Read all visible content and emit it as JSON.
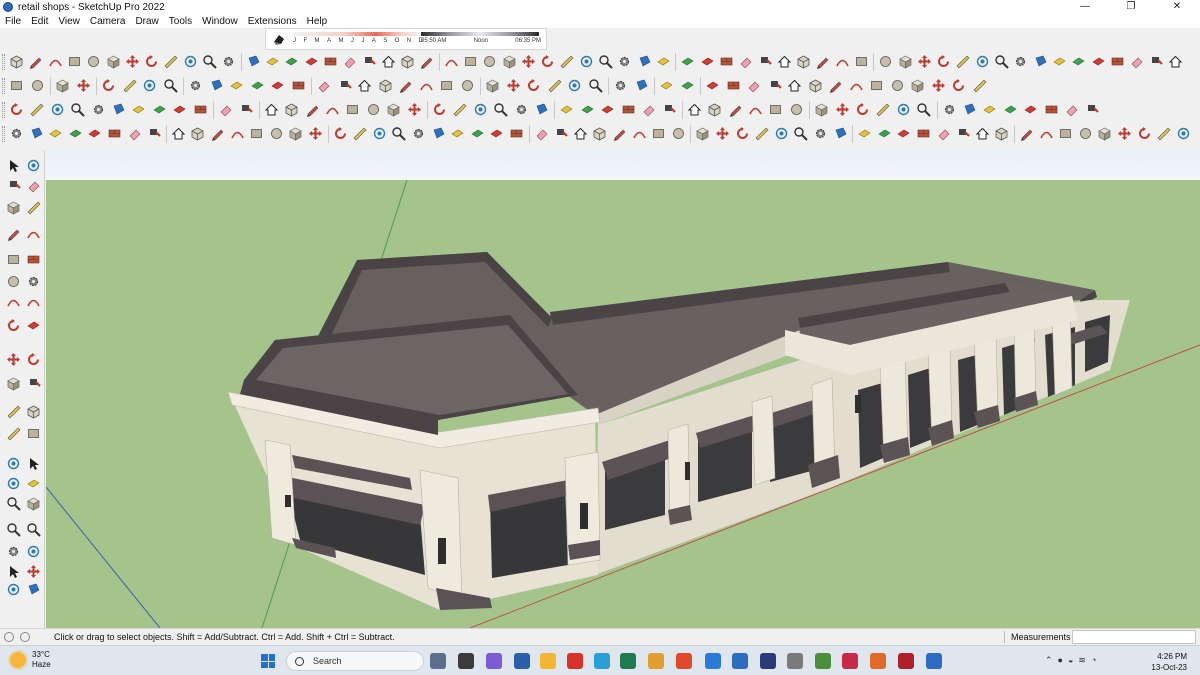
{
  "window": {
    "title": "retail shops - SketchUp Pro 2022",
    "controls": [
      "—",
      "❐",
      "✕"
    ]
  },
  "menu": [
    "File",
    "Edit",
    "View",
    "Camera",
    "Draw",
    "Tools",
    "Window",
    "Extensions",
    "Help"
  ],
  "shadow_widget": {
    "months": [
      "J",
      "F",
      "M",
      "A",
      "M",
      "J",
      "J",
      "A",
      "S",
      "O",
      "N",
      "D"
    ],
    "time_start": "05:50 AM",
    "time_mid": "Noon",
    "time_end": "06:35 PM"
  },
  "status": {
    "hint": "Click or drag to select objects. Shift = Add/Subtract. Ctrl = Add. Shift + Ctrl = Subtract.",
    "measurements_label": "Measurements",
    "measurements_value": ""
  },
  "taskbar": {
    "temperature": "33°C",
    "condition": "Haze",
    "search_label": "Search",
    "time": "4:26 PM",
    "date": "13-Oct-23"
  },
  "colors": {
    "ground": "#a4c48c",
    "sky": "#eef3f9",
    "wall": "#e6e0d2",
    "roof": "#6a6264",
    "parapet": "#4e4749",
    "window": "#353535"
  }
}
